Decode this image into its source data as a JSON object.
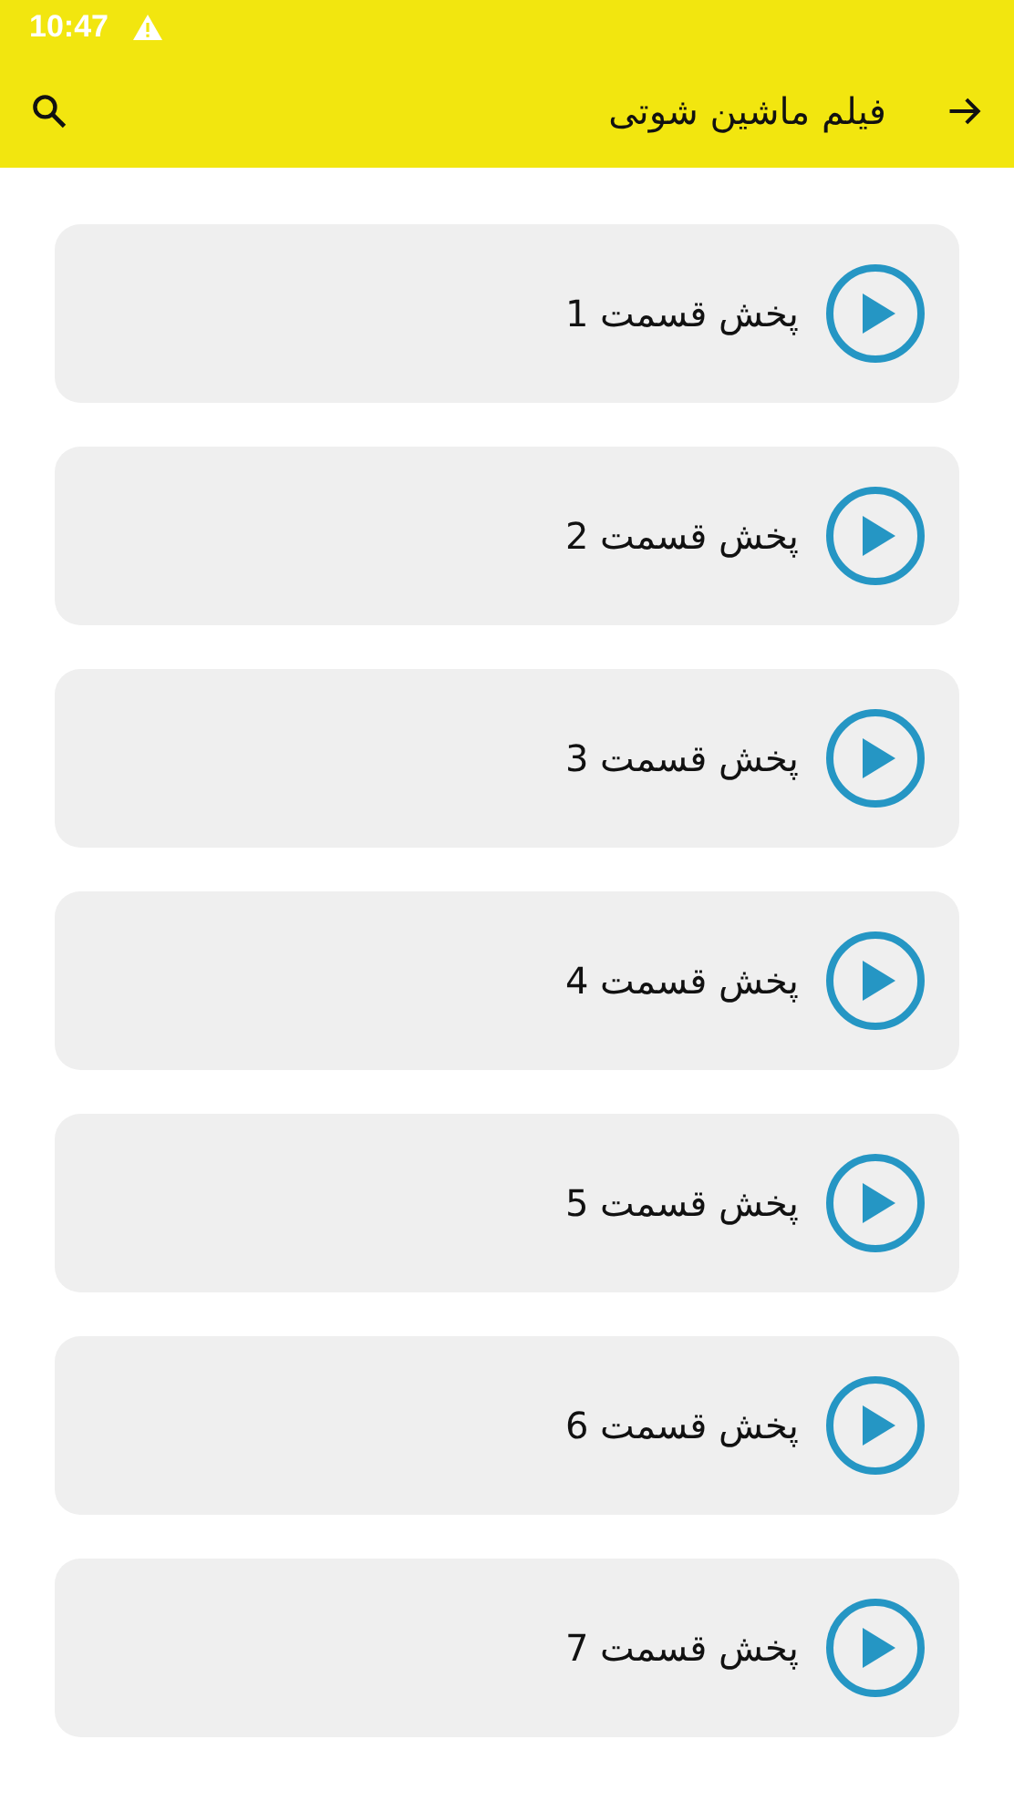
{
  "status_bar": {
    "time": "10:47"
  },
  "app_bar": {
    "title": "فیلم ماشین شوتی"
  },
  "episodes": [
    {
      "label": "پخش قسمت 1"
    },
    {
      "label": "پخش قسمت 2"
    },
    {
      "label": "پخش قسمت 3"
    },
    {
      "label": "پخش قسمت 4"
    },
    {
      "label": "پخش قسمت 5"
    },
    {
      "label": "پخش قسمت 6"
    },
    {
      "label": "پخش قسمت 7"
    }
  ]
}
